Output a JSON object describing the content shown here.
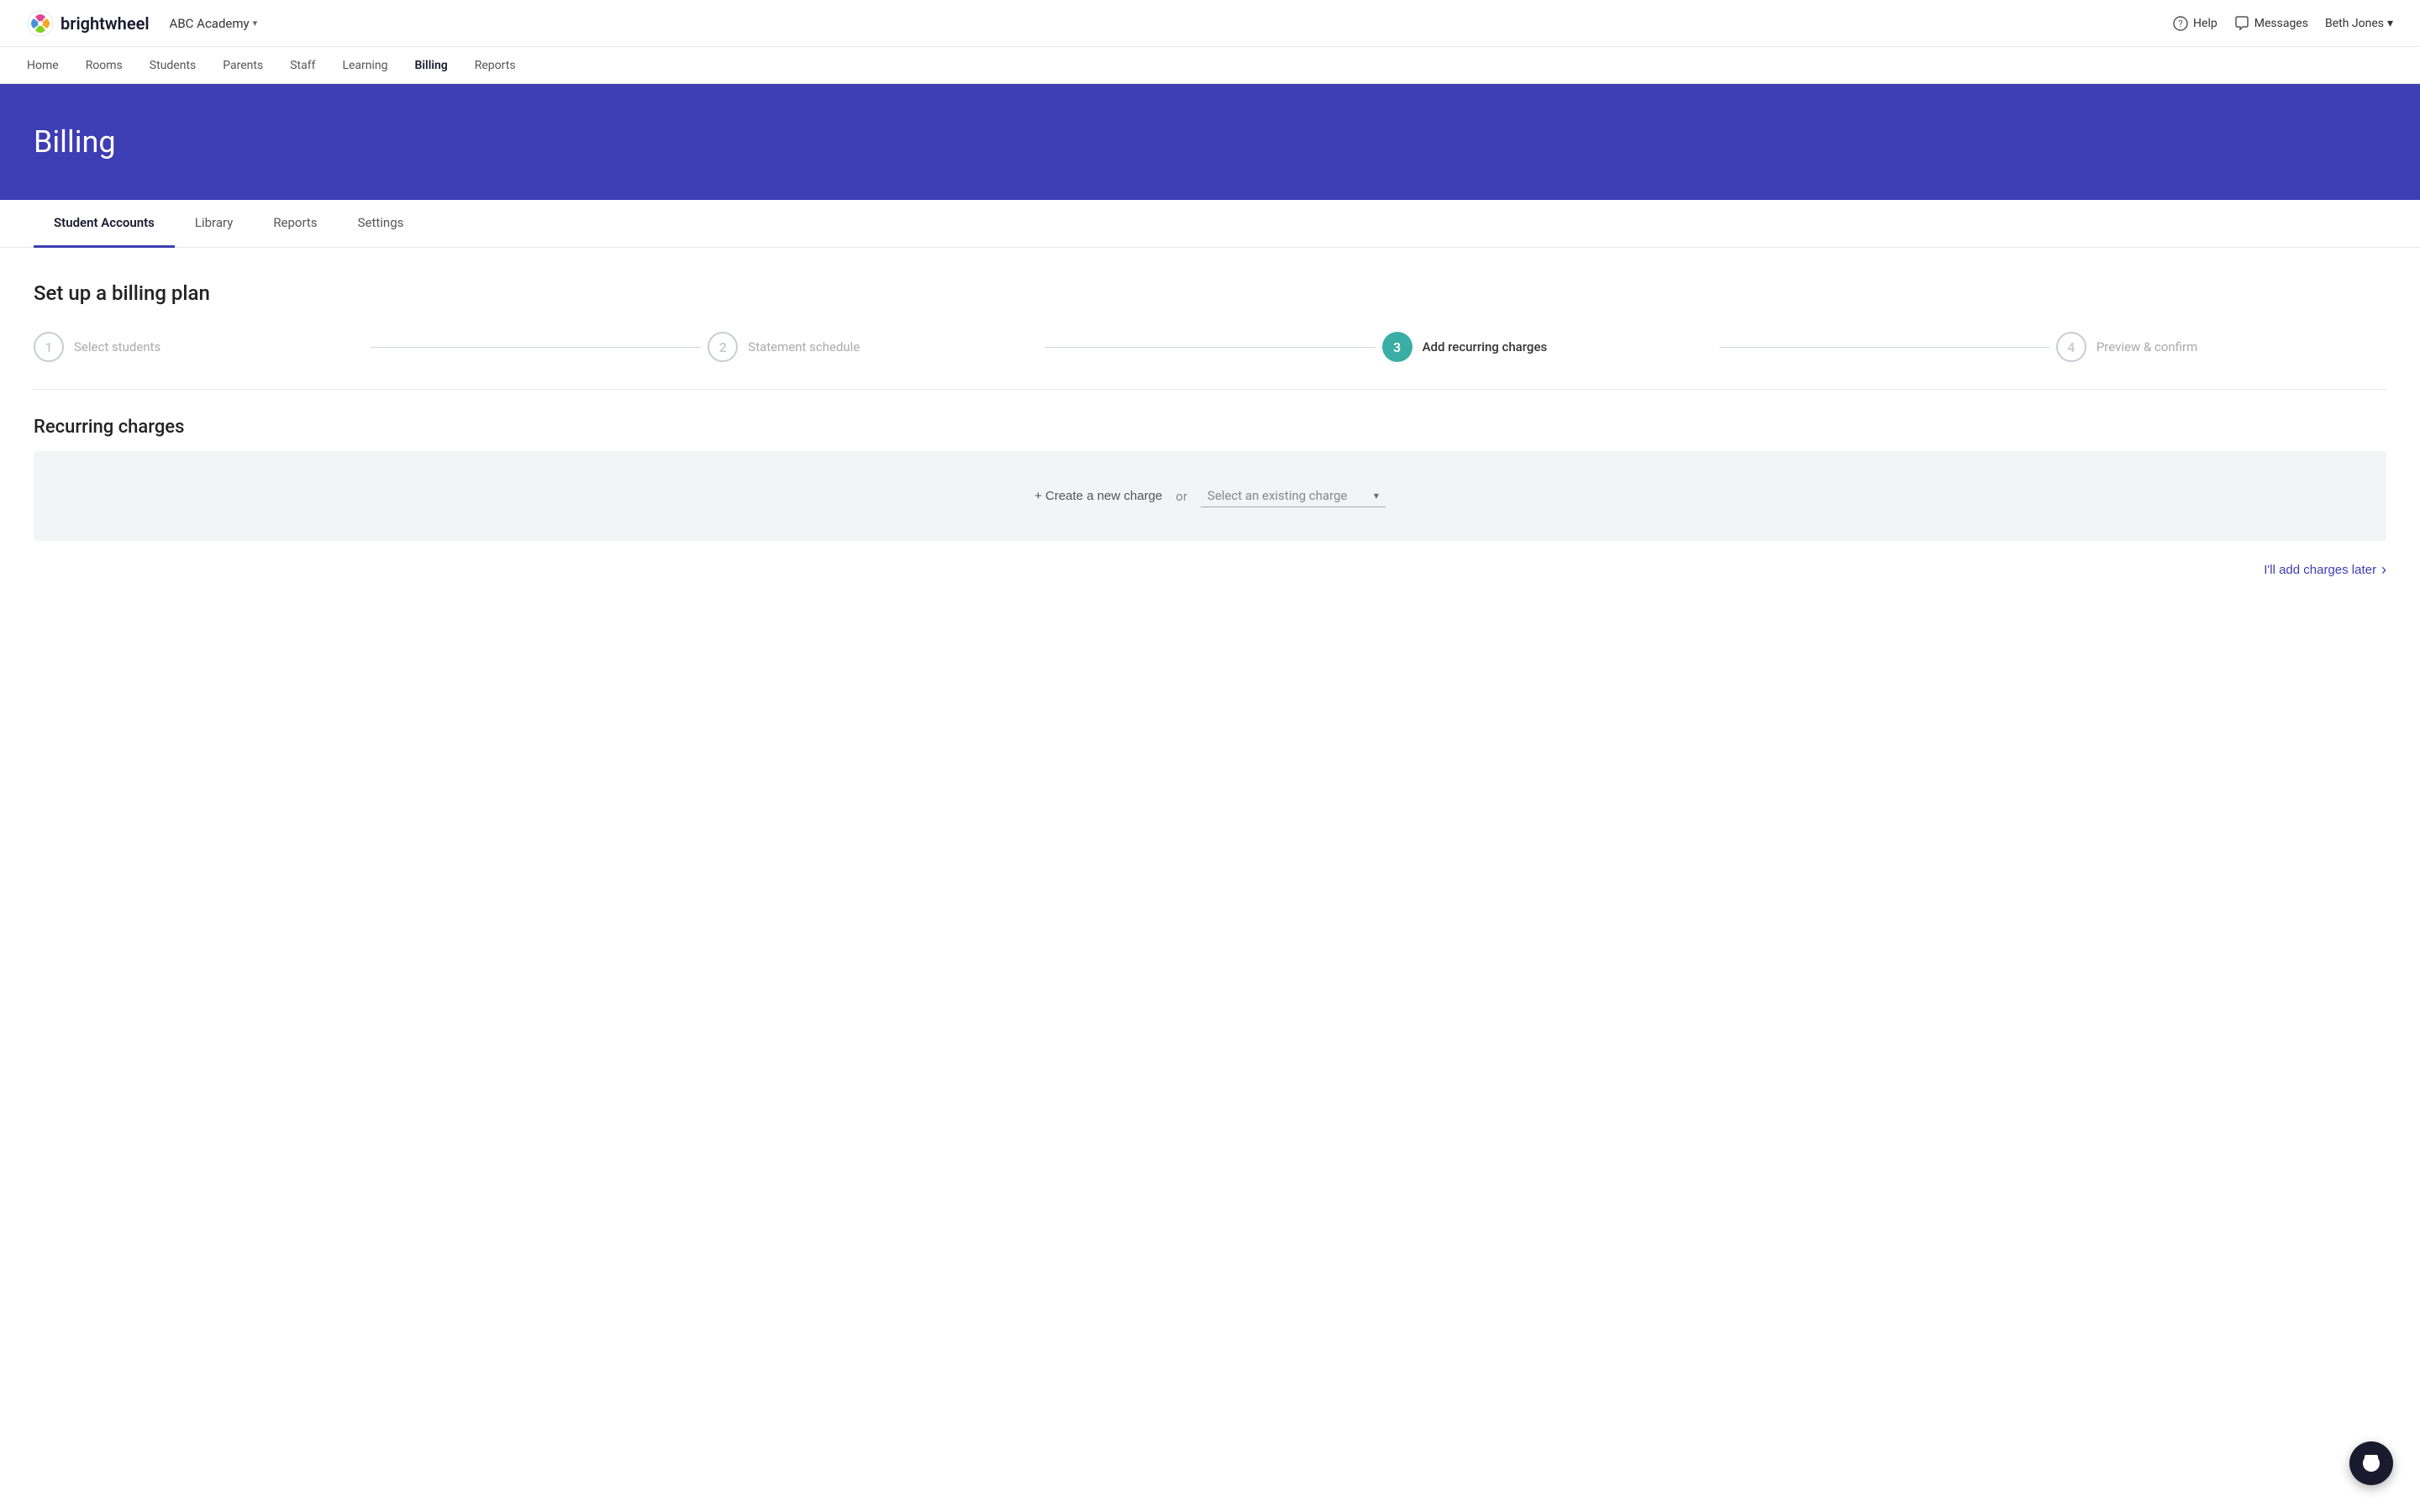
{
  "app": {
    "logo_text": "brightwheel",
    "org_name": "ABC Academy",
    "org_caret": "▾"
  },
  "topbar": {
    "help_label": "Help",
    "messages_label": "Messages",
    "user_name": "Beth Jones",
    "user_caret": "▾"
  },
  "nav": {
    "items": [
      {
        "label": "Home",
        "active": false
      },
      {
        "label": "Rooms",
        "active": false
      },
      {
        "label": "Students",
        "active": false
      },
      {
        "label": "Parents",
        "active": false
      },
      {
        "label": "Staff",
        "active": false
      },
      {
        "label": "Learning",
        "active": false
      },
      {
        "label": "Billing",
        "active": true
      },
      {
        "label": "Reports",
        "active": false
      }
    ]
  },
  "hero": {
    "title": "Billing"
  },
  "tabs": {
    "items": [
      {
        "label": "Student Accounts",
        "active": true
      },
      {
        "label": "Library",
        "active": false
      },
      {
        "label": "Reports",
        "active": false
      },
      {
        "label": "Settings",
        "active": false
      }
    ]
  },
  "billing_plan": {
    "section_title": "Set up a billing plan",
    "steps": [
      {
        "number": "1",
        "label": "Select students",
        "state": "inactive"
      },
      {
        "number": "2",
        "label": "Statement schedule",
        "state": "inactive"
      },
      {
        "number": "3",
        "label": "Add recurring charges",
        "state": "active"
      },
      {
        "number": "4",
        "label": "Preview & confirm",
        "state": "inactive"
      }
    ]
  },
  "recurring_charges": {
    "title": "Recurring charges",
    "create_btn": "+ Create a new charge",
    "or_text": "or",
    "select_placeholder": "Select an existing charge",
    "add_later_btn": "I'll add charges later",
    "add_later_arrow": "›"
  }
}
